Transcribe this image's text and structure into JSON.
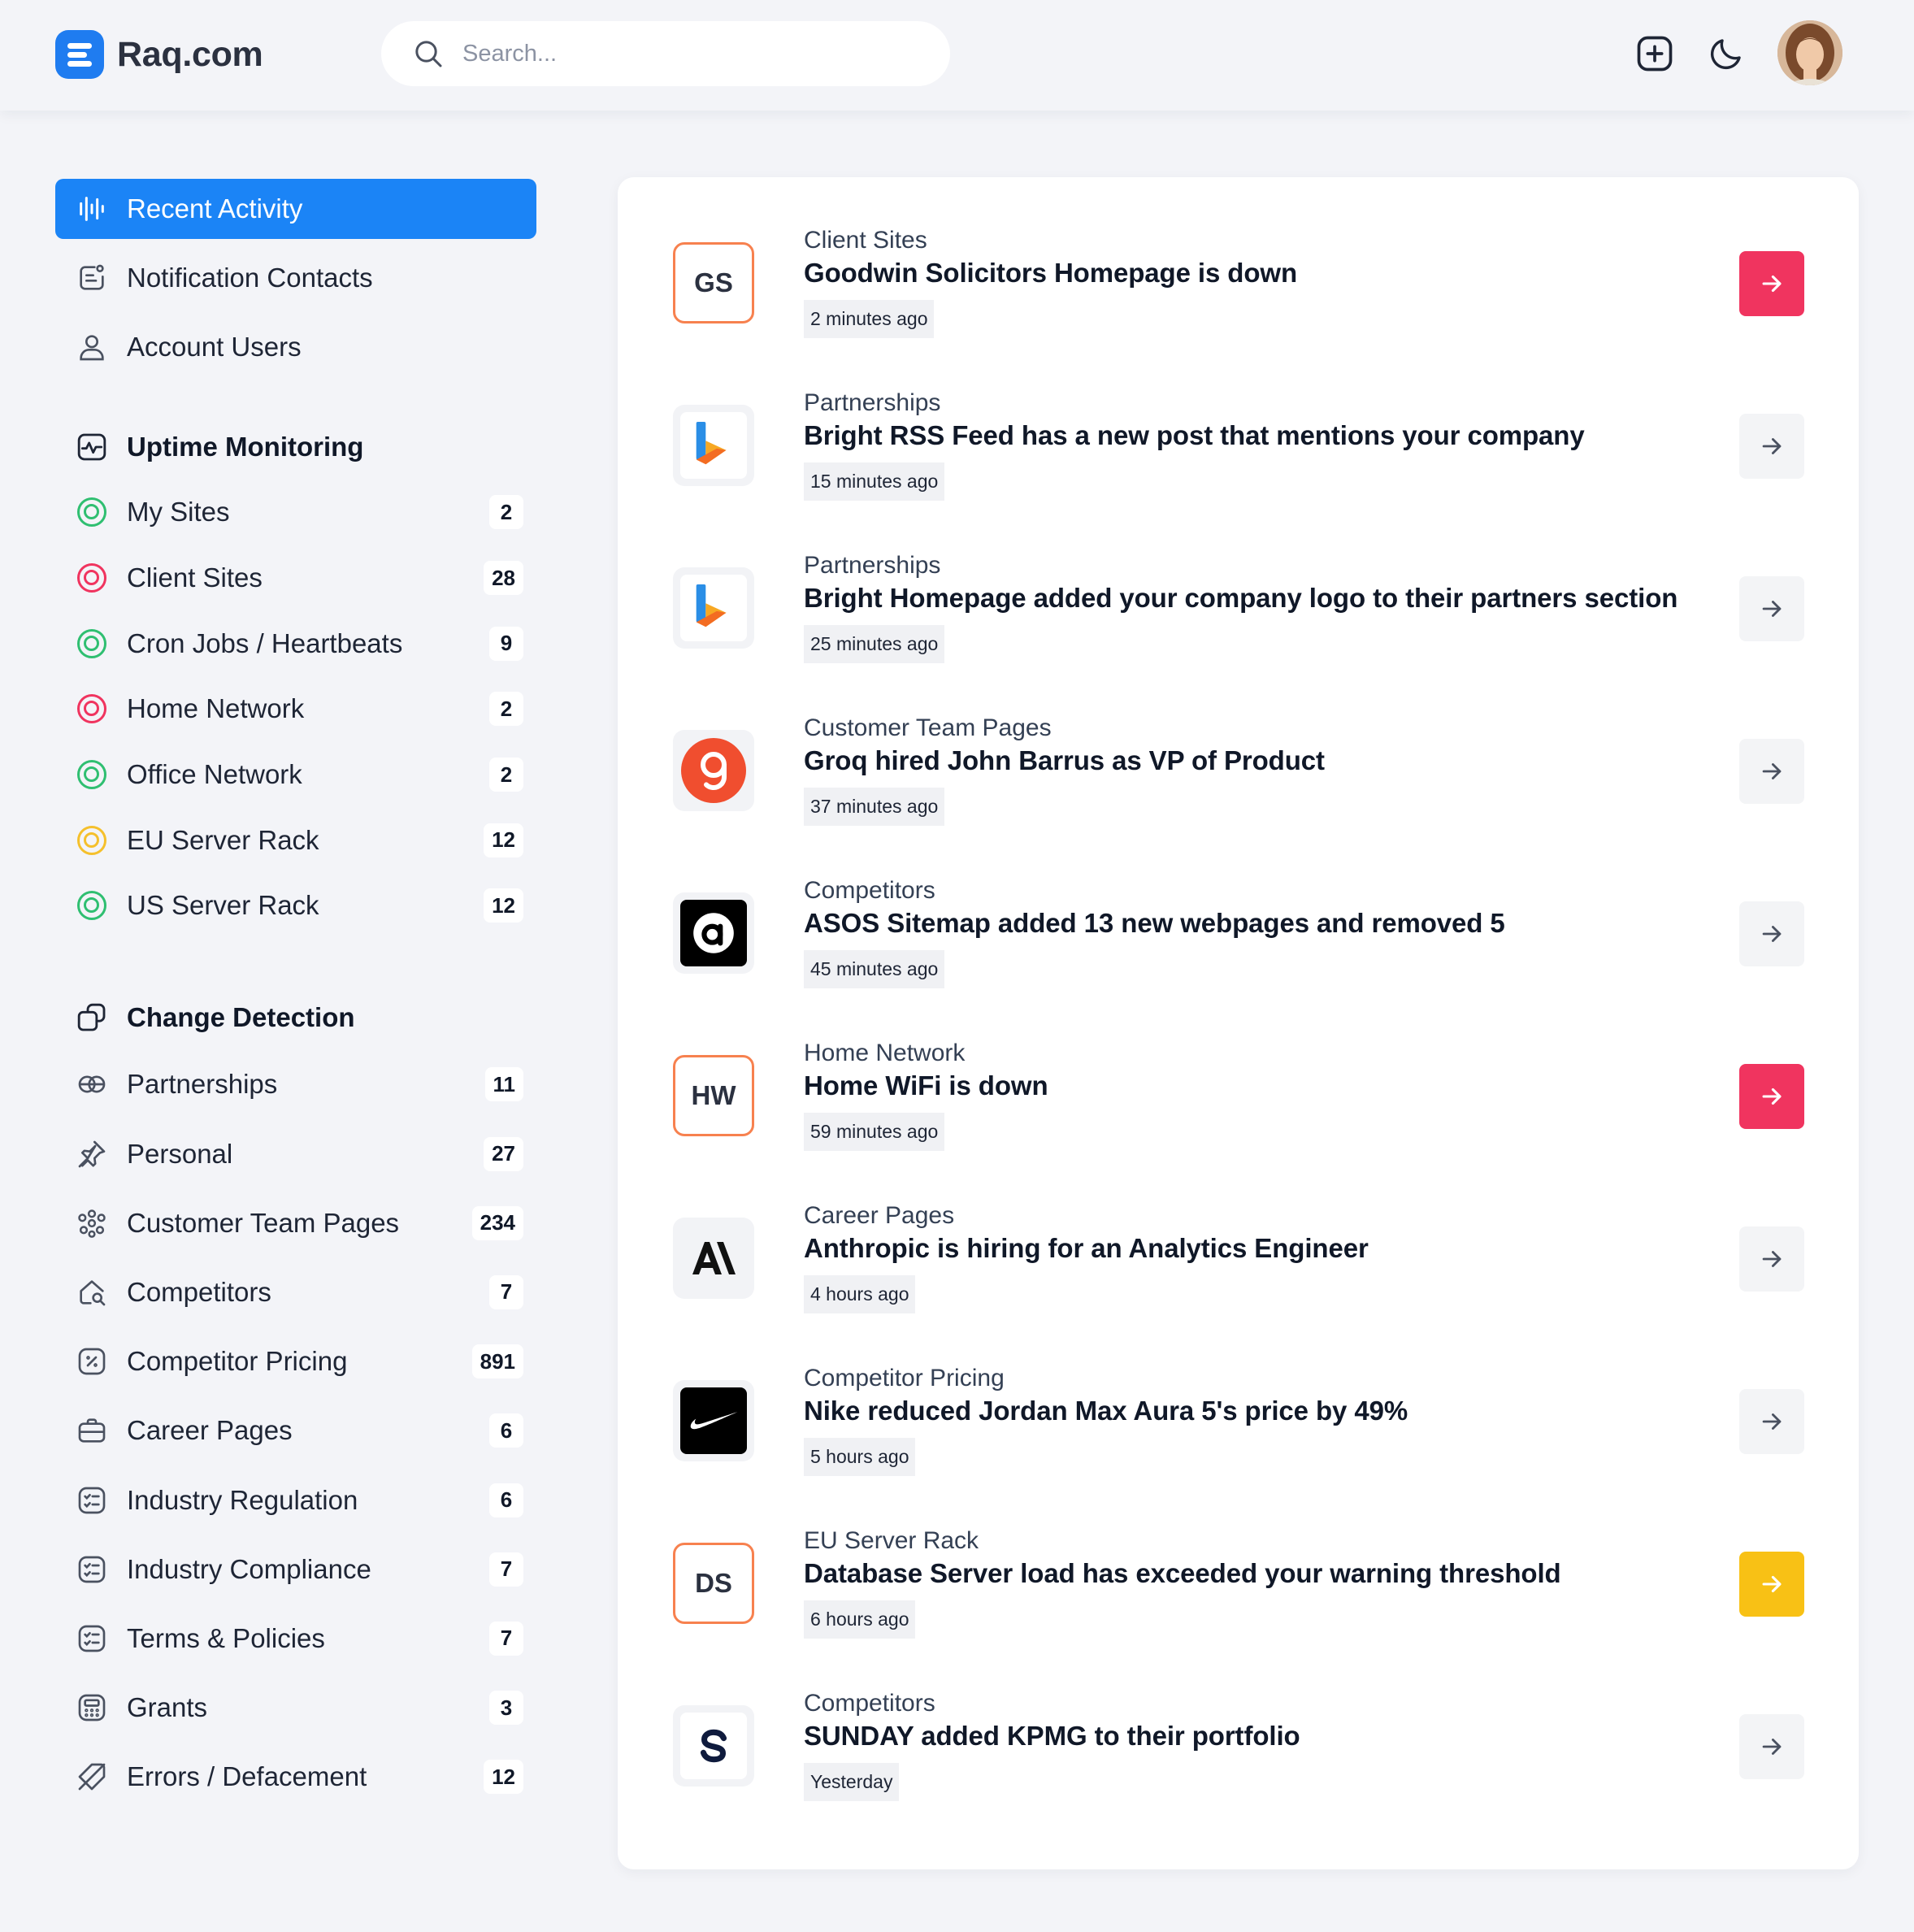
{
  "app": {
    "name": "Raq.com"
  },
  "search": {
    "placeholder": "Search..."
  },
  "sidebar": {
    "top_items": [
      {
        "label": "Recent Activity"
      },
      {
        "label": "Notification Contacts"
      },
      {
        "label": "Account Users"
      }
    ],
    "uptime": {
      "title": "Uptime Monitoring",
      "items": [
        {
          "label": "My Sites",
          "count": "2",
          "status": "green"
        },
        {
          "label": "Client Sites",
          "count": "28",
          "status": "red"
        },
        {
          "label": "Cron Jobs / Heartbeats",
          "count": "9",
          "status": "green"
        },
        {
          "label": "Home Network",
          "count": "2",
          "status": "red"
        },
        {
          "label": "Office Network",
          "count": "2",
          "status": "green"
        },
        {
          "label": "EU Server Rack",
          "count": "12",
          "status": "yellow"
        },
        {
          "label": "US Server Rack",
          "count": "12",
          "status": "green"
        }
      ]
    },
    "change": {
      "title": "Change Detection",
      "items": [
        {
          "label": "Partnerships",
          "count": "11"
        },
        {
          "label": "Personal",
          "count": "27"
        },
        {
          "label": "Customer Team Pages",
          "count": "234"
        },
        {
          "label": "Competitors",
          "count": "7"
        },
        {
          "label": "Competitor Pricing",
          "count": "891"
        },
        {
          "label": "Career Pages",
          "count": "6"
        },
        {
          "label": "Industry Regulation",
          "count": "6"
        },
        {
          "label": "Industry Compliance",
          "count": "7"
        },
        {
          "label": "Terms & Policies",
          "count": "7"
        },
        {
          "label": "Grants",
          "count": "3"
        },
        {
          "label": "Errors / Defacement",
          "count": "12"
        }
      ]
    }
  },
  "colors": {
    "accent": "#1b84f6",
    "alert_red": "#f0345f",
    "warning_yellow": "#f8c115",
    "ok_green": "#2fbf71"
  },
  "activity": [
    {
      "category": "Client Sites",
      "title": "Goodwin Solicitors Homepage is down",
      "time": "2 minutes ago",
      "logo": "GS",
      "action": "red"
    },
    {
      "category": "Partnerships",
      "title": "Bright RSS Feed has a new post that mentions your company",
      "time": "15 minutes ago",
      "logo": "bright-logo",
      "action": "neutral"
    },
    {
      "category": "Partnerships",
      "title": "Bright Homepage added your company logo to their partners section",
      "time": "25 minutes ago",
      "logo": "bright-logo",
      "action": "neutral"
    },
    {
      "category": "Customer Team Pages",
      "title": "Groq hired John Barrus as VP of Product",
      "time": "37 minutes ago",
      "logo": "groq-logo",
      "action": "neutral"
    },
    {
      "category": "Competitors",
      "title": "ASOS Sitemap added 13 new webpages and removed 5",
      "time": "45 minutes ago",
      "logo": "asos-logo",
      "action": "neutral"
    },
    {
      "category": "Home Network",
      "title": "Home WiFi is down",
      "time": "59 minutes ago",
      "logo": "HW",
      "action": "red"
    },
    {
      "category": "Career Pages",
      "title": "Anthropic is hiring for an Analytics Engineer",
      "time": "4 hours ago",
      "logo": "anthropic-logo",
      "action": "neutral"
    },
    {
      "category": "Competitor Pricing",
      "title": "Nike reduced Jordan Max Aura 5's price by 49%",
      "time": "5 hours ago",
      "logo": "nike-logo",
      "action": "neutral"
    },
    {
      "category": "EU Server Rack",
      "title": "Database Server load has exceeded your warning threshold",
      "time": "6 hours ago",
      "logo": "DS",
      "action": "yellow"
    },
    {
      "category": "Competitors",
      "title": "SUNDAY added KPMG to their portfolio",
      "time": "Yesterday",
      "logo": "sunday-logo",
      "action": "neutral"
    }
  ]
}
